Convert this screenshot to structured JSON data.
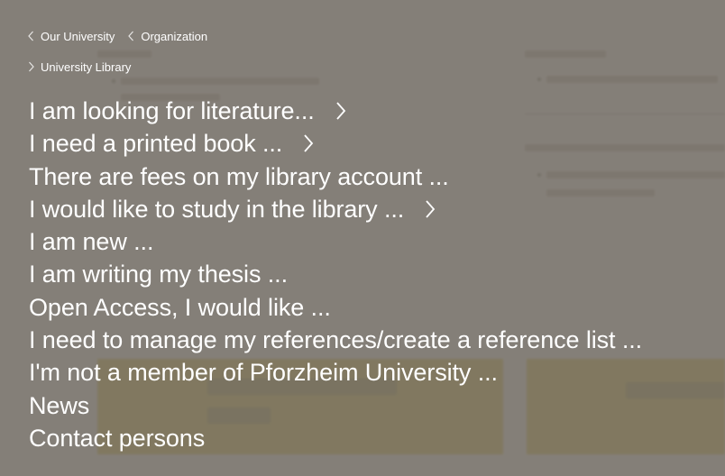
{
  "breadcrumb": {
    "items": [
      {
        "label": "Our University",
        "icon": "chevron-left-icon"
      },
      {
        "label": "Organization",
        "icon": "chevron-left-icon"
      },
      {
        "label": "University Library",
        "icon": "chevron-right-icon"
      }
    ]
  },
  "menu": {
    "items": [
      {
        "label": "I am looking for literature...",
        "has_submenu": true
      },
      {
        "label": "I need a printed book ...",
        "has_submenu": true
      },
      {
        "label": "There are fees on my library account ...",
        "has_submenu": false
      },
      {
        "label": "I would like to study in the library ...",
        "has_submenu": true
      },
      {
        "label": "I am new ...",
        "has_submenu": false
      },
      {
        "label": "I am writing my thesis ...",
        "has_submenu": false
      },
      {
        "label": "Open Access, I would like ...",
        "has_submenu": false
      },
      {
        "label": "I need to manage my references/create a reference list ...",
        "has_submenu": false
      },
      {
        "label": "I'm not a member of Pforzheim University ...",
        "has_submenu": false
      },
      {
        "label": "News",
        "has_submenu": false
      },
      {
        "label": "Contact persons",
        "has_submenu": false
      }
    ]
  },
  "colors": {
    "overlay": "#706a62",
    "text": "#ffffff",
    "accent_yellow": "#e6cf55"
  }
}
